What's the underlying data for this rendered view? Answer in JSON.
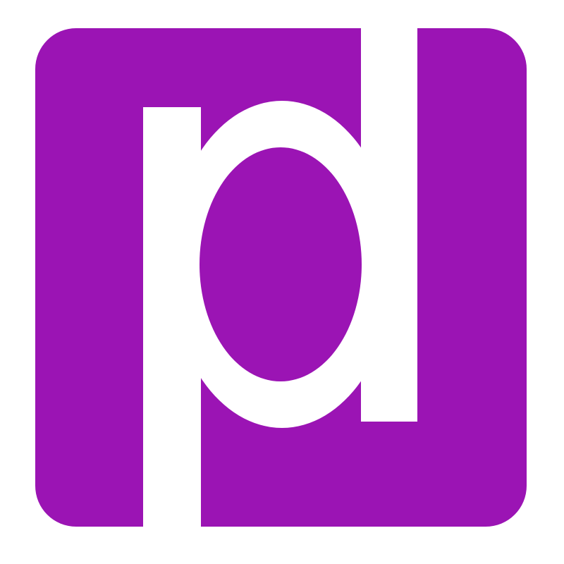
{
  "logo": {
    "lettering": "pd",
    "icon": "pd-monogram-icon",
    "colors": {
      "background": "#ffffff",
      "tile": "#9b14b4",
      "letters": "#ffffff"
    }
  }
}
